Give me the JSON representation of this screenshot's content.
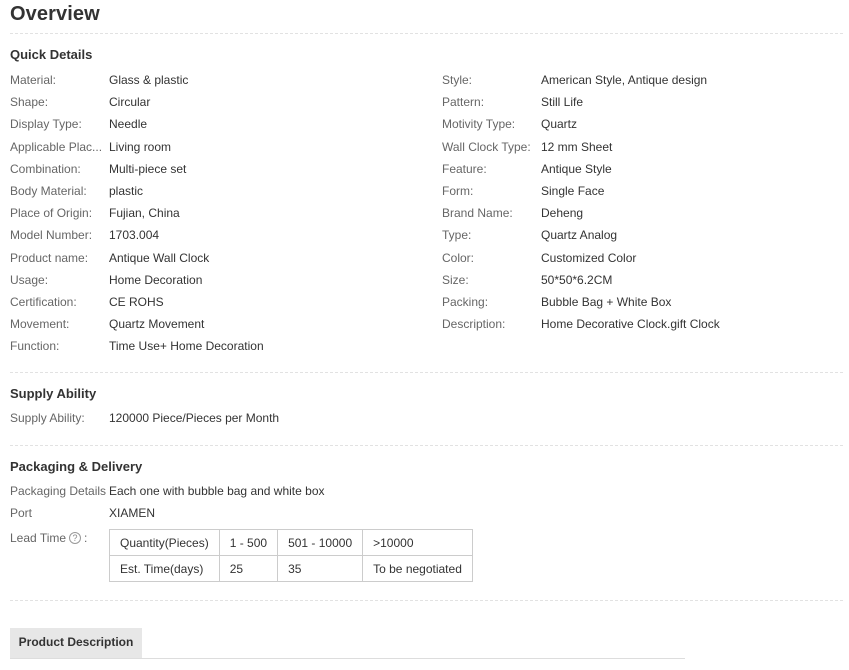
{
  "overview_title": "Overview",
  "quick_details": {
    "title": "Quick Details",
    "left": [
      {
        "label": "Material:",
        "value": "Glass & plastic"
      },
      {
        "label": "Shape:",
        "value": "Circular"
      },
      {
        "label": "Display Type:",
        "value": "Needle"
      },
      {
        "label": "Applicable Plac...",
        "value": "Living room"
      },
      {
        "label": "Combination:",
        "value": "Multi-piece set"
      },
      {
        "label": "Body Material:",
        "value": "plastic"
      },
      {
        "label": "Place of Origin:",
        "value": "Fujian, China"
      },
      {
        "label": "Model Number:",
        "value": "1703.004"
      },
      {
        "label": "Product name:",
        "value": "Antique Wall Clock"
      },
      {
        "label": "Usage:",
        "value": "Home Decoration"
      },
      {
        "label": "Certification:",
        "value": "CE ROHS"
      },
      {
        "label": "Movement:",
        "value": "Quartz Movement"
      },
      {
        "label": "Function:",
        "value": "Time Use+ Home Decoration"
      }
    ],
    "right": [
      {
        "label": "Style:",
        "value": "American Style, Antique design"
      },
      {
        "label": "Pattern:",
        "value": "Still Life"
      },
      {
        "label": "Motivity Type:",
        "value": "Quartz"
      },
      {
        "label": "Wall Clock Type:",
        "value": "12 mm Sheet"
      },
      {
        "label": "Feature:",
        "value": "Antique Style"
      },
      {
        "label": "Form:",
        "value": "Single Face"
      },
      {
        "label": "Brand Name:",
        "value": "Deheng"
      },
      {
        "label": "Type:",
        "value": "Quartz Analog"
      },
      {
        "label": "Color:",
        "value": "Customized Color"
      },
      {
        "label": "Size:",
        "value": "50*50*6.2CM"
      },
      {
        "label": "Packing:",
        "value": "Bubble Bag + White Box"
      },
      {
        "label": "Description:",
        "value": "Home Decorative Clock.gift Clock"
      }
    ]
  },
  "supply_ability": {
    "title": "Supply Ability",
    "label": "Supply Ability:",
    "value": "120000 Piece/Pieces per Month"
  },
  "packaging": {
    "title": "Packaging & Delivery",
    "details_label": "Packaging Details",
    "details_value": "Each one with bubble bag and white box",
    "port_label": "Port",
    "port_value": "XIAMEN",
    "lead_time_label": "Lead Time",
    "help_icon": "?",
    "lead_table": {
      "header": [
        "Quantity(Pieces)",
        "1 - 500",
        "501 - 10000",
        ">10000"
      ],
      "row": [
        "Est. Time(days)",
        "25",
        "35",
        "To be negotiated"
      ]
    }
  },
  "tabs": {
    "product_description": "Product Description"
  }
}
